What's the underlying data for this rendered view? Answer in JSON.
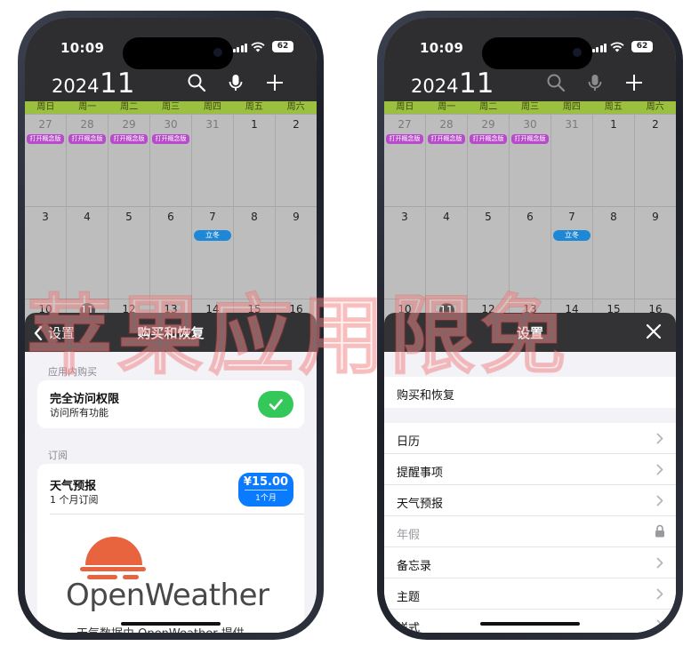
{
  "left_phone": {
    "status": {
      "time": "10:09",
      "battery": "62"
    },
    "calendar": {
      "year": "2024",
      "month": "11",
      "weekdays": [
        "周日",
        "周一",
        "周二",
        "周三",
        "周四",
        "周五",
        "周六"
      ],
      "weeks": [
        {
          "days": [
            "27",
            "28",
            "29",
            "30",
            "31",
            "1",
            "2"
          ]
        },
        {
          "days": [
            "3",
            "4",
            "5",
            "6",
            "7",
            "8",
            "9"
          ]
        },
        {
          "days": [
            "10",
            "11",
            "12",
            "13",
            "14",
            "15",
            "16"
          ]
        }
      ],
      "event_label": "打开概念版",
      "holiday_label": "立冬"
    },
    "sheet": {
      "back_label": "设置",
      "title": "购买和恢复",
      "section_iap": "应用内购买",
      "full_access_title": "完全访问权限",
      "full_access_sub": "访问所有功能",
      "section_sub": "订阅",
      "weather_title": "天气预报",
      "weather_sub": "1 个月订阅",
      "price": "¥15.00",
      "price_period": "1个月",
      "provider_logo_text": "OpenWeather",
      "provider_credit": "天气数据由 OpenWeather 提供"
    }
  },
  "right_phone": {
    "status": {
      "time": "10:09",
      "battery": "62"
    },
    "calendar": {
      "year": "2024",
      "month": "11",
      "weekdays": [
        "周日",
        "周一",
        "周二",
        "周三",
        "周四",
        "周五",
        "周六"
      ],
      "weeks": [
        {
          "days": [
            "27",
            "28",
            "29",
            "30",
            "31",
            "1",
            "2"
          ]
        },
        {
          "days": [
            "3",
            "4",
            "5",
            "6",
            "7",
            "8",
            "9"
          ]
        },
        {
          "days": [
            "10",
            "11",
            "12",
            "13",
            "14",
            "15",
            "16"
          ]
        }
      ],
      "event_label": "打开概念版",
      "holiday_label": "立冬"
    },
    "sheet": {
      "title": "设置",
      "purchase_restore": "购买和恢复",
      "items": [
        {
          "label": "日历",
          "locked": false
        },
        {
          "label": "提醒事项",
          "locked": false
        },
        {
          "label": "天气预报",
          "locked": false
        },
        {
          "label": "年假",
          "locked": true
        },
        {
          "label": "备忘录",
          "locked": false
        },
        {
          "label": "主题",
          "locked": false
        },
        {
          "label": "样式",
          "locked": false
        }
      ]
    }
  },
  "watermark_text": "苹果应用限免",
  "colors": {
    "accent_green": "#34c759",
    "accent_blue": "#0a7aff",
    "event_purple": "#b64cc9",
    "weekday_bar": "#9bbf3f",
    "openweather_orange": "#e8643f"
  }
}
